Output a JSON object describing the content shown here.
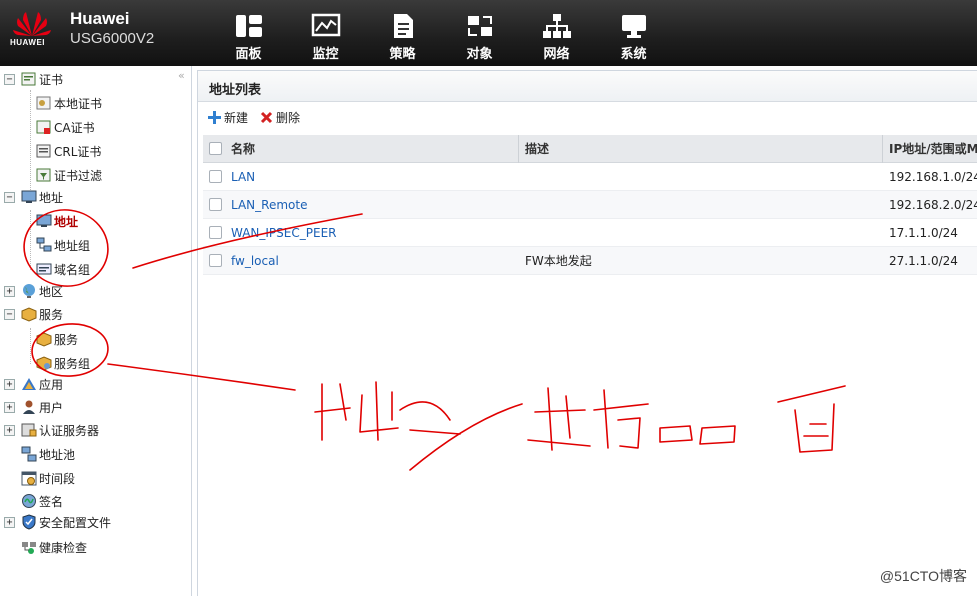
{
  "header": {
    "logo_text": "HUAWEI",
    "brand": "Huawei",
    "model": "USG6000V2",
    "nav": [
      {
        "label": "面板",
        "icon": "dashboard-icon"
      },
      {
        "label": "监控",
        "icon": "monitor-icon"
      },
      {
        "label": "策略",
        "icon": "policy-icon"
      },
      {
        "label": "对象",
        "icon": "object-icon",
        "active": true
      },
      {
        "label": "网络",
        "icon": "network-icon"
      },
      {
        "label": "系统",
        "icon": "system-icon"
      }
    ]
  },
  "sidebar": {
    "collapse": "«",
    "items": [
      {
        "label": "证书",
        "expander": "−"
      },
      {
        "label": "本地证书"
      },
      {
        "label": "CA证书"
      },
      {
        "label": "CRL证书"
      },
      {
        "label": "证书过滤"
      },
      {
        "label": "地址",
        "expander": "−"
      },
      {
        "label": "地址",
        "selected": true
      },
      {
        "label": "地址组"
      },
      {
        "label": "域名组"
      },
      {
        "label": "地区",
        "expander": "+"
      },
      {
        "label": "服务",
        "expander": "−"
      },
      {
        "label": "服务"
      },
      {
        "label": "服务组"
      },
      {
        "label": "应用",
        "expander": "+"
      },
      {
        "label": "用户",
        "expander": "+"
      },
      {
        "label": "认证服务器",
        "expander": "+"
      },
      {
        "label": "地址池"
      },
      {
        "label": "时间段"
      },
      {
        "label": "签名"
      },
      {
        "label": "安全配置文件",
        "expander": "+"
      },
      {
        "label": "健康检查"
      }
    ]
  },
  "main": {
    "title": "地址列表",
    "toolbar": {
      "new_label": "新建",
      "delete_label": "删除"
    },
    "columns": {
      "name": "名称",
      "desc": "描述",
      "ip": "IP地址/范围或MA"
    },
    "rows": [
      {
        "name": "LAN",
        "desc": "",
        "ip": "192.168.1.0/24"
      },
      {
        "name": "LAN_Remote",
        "desc": "",
        "ip": "192.168.2.0/24"
      },
      {
        "name": "WAN_IPSEC_PEER",
        "desc": "",
        "ip": "17.1.1.0/24"
      },
      {
        "name": "fw_local",
        "desc": "FW本地发起",
        "ip": "27.1.1.0/24"
      }
    ]
  },
  "watermark": "@51CTO博客",
  "colors": {
    "annotation": "#e00000",
    "link": "#1a5fb4",
    "selected": "#b00000"
  }
}
